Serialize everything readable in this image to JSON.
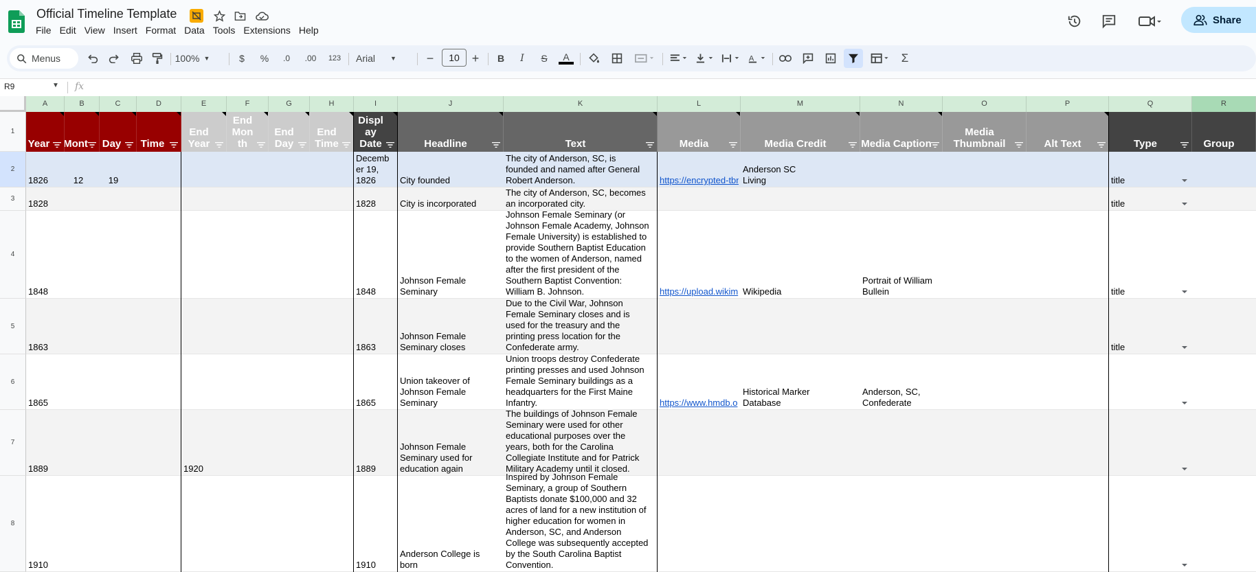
{
  "doc": {
    "title": "Official Timeline Template"
  },
  "menus": [
    "File",
    "Edit",
    "View",
    "Insert",
    "Format",
    "Data",
    "Tools",
    "Extensions",
    "Help"
  ],
  "share_label": "Share",
  "toolbar": {
    "search_label": "Menus",
    "zoom": "100%",
    "currency": "$",
    "percent": "%",
    "dec_minus": ".0",
    "dec_plus": ".00",
    "number_format": "123",
    "font": "Arial",
    "font_size": "10"
  },
  "formula": {
    "cell_ref": "R9",
    "fx": "fx"
  },
  "columns": [
    "A",
    "B",
    "C",
    "D",
    "E",
    "F",
    "G",
    "H",
    "I",
    "J",
    "K",
    "L",
    "M",
    "N",
    "O",
    "P",
    "Q",
    "R"
  ],
  "header_labels": {
    "A": "Year",
    "B": "Mont",
    "C": "Day",
    "D": "Time",
    "E": "End\nYear",
    "F": "End\nMon\nth",
    "G": "End\nDay",
    "H": "End\nTime",
    "I": "Displ\nay\nDate",
    "J": "Headline",
    "K": "Text",
    "L": "Media",
    "M": "Media Credit",
    "N": "Media Caption",
    "O": "Media\nThumbnail",
    "P": "Alt Text",
    "Q": "Type",
    "R": "Group"
  },
  "header_colors": {
    "date": "#980000",
    "end": "#cccccc",
    "display": "#434343",
    "content": "#666666",
    "media": "#999999",
    "type": "#434343"
  },
  "row_numbers": [
    "1",
    "2",
    "3",
    "4",
    "5",
    "6",
    "7",
    "8"
  ],
  "rows": [
    {
      "year": "1826",
      "month": "12",
      "day": "19",
      "end_year": "",
      "display_date": "Decemb\ner 19,\n1826",
      "headline": "City founded",
      "text": "The city of Anderson, SC, is\nfounded and named after General\nRobert Anderson.",
      "media": "https://encrypted-tbn",
      "media_credit": "Anderson SC\nLiving",
      "media_caption": "",
      "type": "title"
    },
    {
      "year": "1828",
      "month": "",
      "day": "",
      "end_year": "",
      "display_date": "1828",
      "headline": "City is incorporated",
      "text": "The city of Anderson, SC, becomes\nan incorporated city.",
      "media": "",
      "media_credit": "",
      "media_caption": "",
      "type": "title"
    },
    {
      "year": "1848",
      "month": "",
      "day": "",
      "end_year": "",
      "display_date": "1848",
      "headline": "Johnson Female\nSeminary",
      "text": "Johnson Female Seminary (or\nJohnson Female Academy, Johnson\nFemale University) is established to\nprovide Southern Baptist Education\nto the women of Anderson, named\nafter the first president of the\nSouthern Baptist Convention:\nWilliam B. Johnson.",
      "media": "https://upload.wikim",
      "media_credit": "Wikipedia",
      "media_caption": "Portrait of William Bullein\nJohnson",
      "type": "title"
    },
    {
      "year": "1863",
      "month": "",
      "day": "",
      "end_year": "",
      "display_date": "1863",
      "headline": "Johnson Female\nSeminary closes",
      "text": "Due to the Civil War, Johnson\nFemale Seminary closes and is\nused for the treasury and the\nprinting press location for the\nConfederate army.",
      "media": "",
      "media_credit": "",
      "media_caption": "",
      "type": "title"
    },
    {
      "year": "1865",
      "month": "",
      "day": "",
      "end_year": "",
      "display_date": "1865",
      "headline": "Union takeover of\nJohnson Female\nSeminary",
      "text": "Union troops destroy Confederate\nprinting presses and used Johnson\nFemale Seminary buildings as a\nheadquarters for the First Maine\nInfantry.",
      "media": "https://www.hmdb.o",
      "media_credit": "Historical Marker\nDatabase",
      "media_caption": "Anderson, SC, Confederate\nMonument",
      "type": ""
    },
    {
      "year": "1889",
      "month": "",
      "day": "",
      "end_year": "1920",
      "display_date": "1889",
      "headline": "Johnson Female\nSeminary used for\neducation again",
      "text": "The buildings of Johnson Female\nSeminary were used for other\neducational purposes over the\nyears, both for the Carolina\nCollegiate Institute and for Patrick\nMilitary Academy until it closed.",
      "media": "",
      "media_credit": "",
      "media_caption": "",
      "type": ""
    },
    {
      "year": "1910",
      "month": "",
      "day": "",
      "end_year": "",
      "display_date": "1910",
      "headline": "Anderson College is\nborn",
      "text": "Inspired by Johnson Female\nSeminary, a group of Southern\nBaptists donate $100,000 and 32\nacres of land for a new institution of\nhigher education for women in\nAnderson, SC, and Anderson\nCollege was subsequently accepted\nby the South Carolina Baptist\nConvention.",
      "media": "",
      "media_credit": "",
      "media_caption": "",
      "type": ""
    }
  ]
}
